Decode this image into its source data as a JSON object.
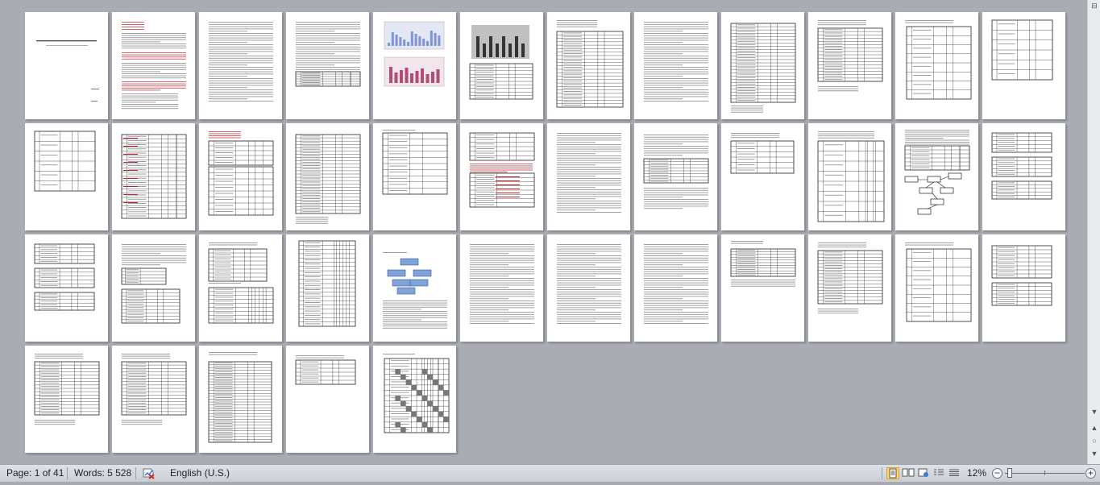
{
  "status_bar": {
    "page_info": "Page: 1 of 41",
    "words": "Words: 5 528",
    "language": "English (U.S.)",
    "zoom_level": "12%"
  },
  "document": {
    "page_count": 41,
    "title_line": "Отчет ЗООИ по программе тема 4"
  },
  "colors": {
    "workspace": "#a9acb2",
    "page": "#ffffff",
    "accent_red": "#c0202a",
    "status_bar": "#d3d8de"
  },
  "icons": {
    "proofing": "proofing-errors-icon",
    "print_layout": "print-layout-icon",
    "full_screen_reading": "full-screen-reading-icon",
    "web_layout": "web-layout-icon",
    "outline": "outline-icon",
    "draft": "draft-icon",
    "zoom_out": "zoom-out-icon",
    "zoom_in": "zoom-in-icon"
  }
}
